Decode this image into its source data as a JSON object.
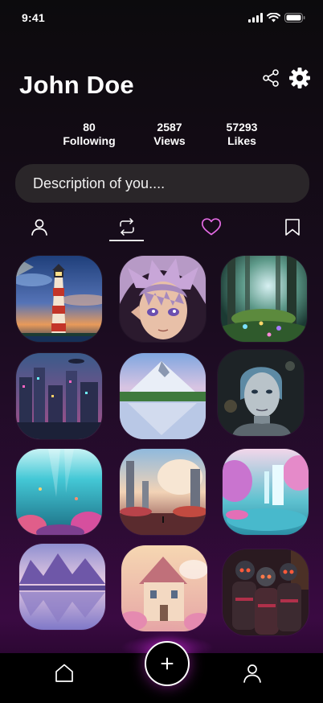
{
  "status_bar": {
    "time": "9:41"
  },
  "profile": {
    "name": "John Doe",
    "stats": [
      {
        "value": "80",
        "label": "Following"
      },
      {
        "value": "2587",
        "label": "Views"
      },
      {
        "value": "57293",
        "label": "Likes"
      }
    ],
    "description_placeholder": "Description of you...."
  },
  "header_icons": [
    "share-icon",
    "gear-icon"
  ],
  "tabs": [
    {
      "icon": "user-icon",
      "selected": false
    },
    {
      "icon": "repost-icon",
      "selected": true
    },
    {
      "icon": "heart-icon",
      "selected": false,
      "color": "#e46be4"
    },
    {
      "icon": "bookmark-icon",
      "selected": false
    }
  ],
  "gallery": [
    {
      "subject": "lighthouse at sunset"
    },
    {
      "subject": "anime character with lilac hair"
    },
    {
      "subject": "enchanted forest"
    },
    {
      "subject": "futuristic city"
    },
    {
      "subject": "snowy mountain lake"
    },
    {
      "subject": "female android"
    },
    {
      "subject": "underwater coral reef"
    },
    {
      "subject": "fantasy castle landscape"
    },
    {
      "subject": "waterfall lagoon"
    },
    {
      "subject": "purple mountain reflection"
    },
    {
      "subject": "pastel house"
    },
    {
      "subject": "robot group"
    }
  ],
  "bottom_nav": [
    "home-icon",
    "plus-icon",
    "user-icon"
  ],
  "colors": {
    "accent": "#c12ad0",
    "card": "#2a2629",
    "text": "#ffffff"
  }
}
